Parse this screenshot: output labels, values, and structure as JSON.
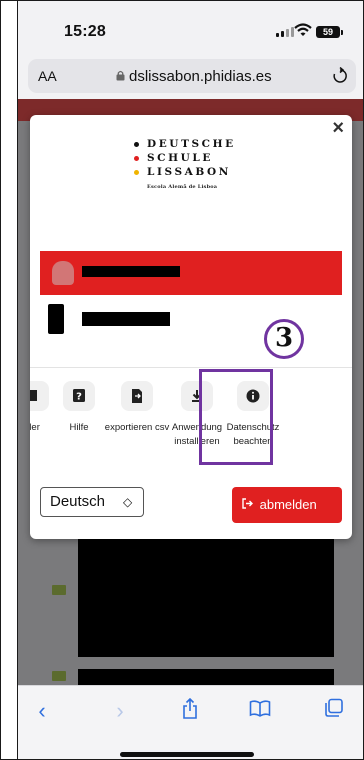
{
  "status_bar": {
    "time": "15:28",
    "battery": "59"
  },
  "browser": {
    "text_size_label": "AA",
    "url": "dslissabon.phidias.es",
    "reload_icon": "reload-icon"
  },
  "logo": {
    "lines": [
      "DEUTSCHE",
      "SCHULE",
      "LISSABON"
    ],
    "dot_colors": [
      "#111111",
      "#e02020",
      "#f0b400"
    ],
    "subtitle": "Escola Alemã de Lisboa"
  },
  "modal": {
    "close_label": "×",
    "accent_color": "#e02020"
  },
  "actions": [
    {
      "label": "der",
      "icon": "file-icon"
    },
    {
      "label": "Hilfe",
      "icon": "question-icon"
    },
    {
      "label": "exportieren csv",
      "icon": "export-icon"
    },
    {
      "label": "Anwendung installieren",
      "icon": "download-icon"
    },
    {
      "label": "Datenschutz beachten",
      "icon": "info-icon"
    }
  ],
  "annotation": {
    "step_number": "3",
    "color": "#7034a0"
  },
  "language_select": {
    "value": "Deutsch"
  },
  "logout_button": {
    "label": "abmelden"
  },
  "toolbar": {
    "icons": [
      "back-icon",
      "forward-icon",
      "share-icon",
      "bookmarks-icon",
      "tabs-icon"
    ]
  }
}
